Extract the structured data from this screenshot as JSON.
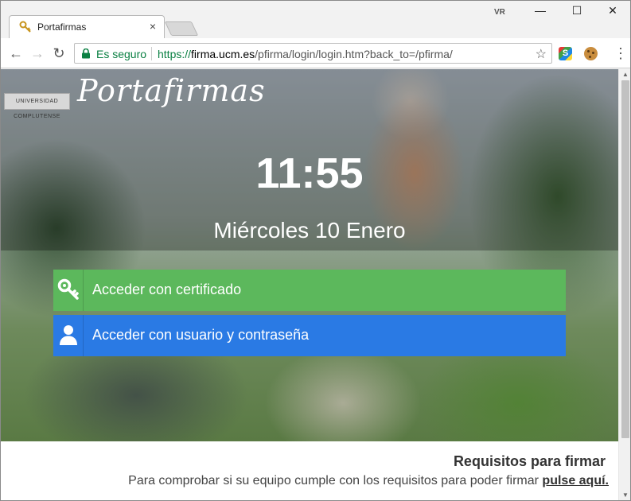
{
  "browser": {
    "tab_title": "Portafirmas",
    "tab_close": "×",
    "profile_badge": "VR",
    "window_min": "—",
    "window_max": "☐",
    "window_close": "✕",
    "secure_label": "Es seguro",
    "url_scheme": "https://",
    "url_host": "firma.ucm.es",
    "url_path": "/pfirma/login/login.htm?back_to=/pfirma/",
    "back": "←",
    "forward": "→",
    "reload": "↻",
    "bookmark": "☆",
    "extension_1": "S",
    "menu": "⋮",
    "icons": {
      "favicon": "key-icon",
      "lock": "lock-icon",
      "star": "star-icon",
      "extension_1": "extension-s-icon",
      "extension_2": "cookie-icon"
    }
  },
  "page": {
    "logo_institution": "UNIVERSIDAD COMPLUTENSE",
    "logo_text": "Portafirmas",
    "clock": "11:55",
    "date": "Miércoles 10 Enero",
    "buttons": {
      "certificate_label": "Acceder con certificado",
      "certificate_icon": "key-icon",
      "user_label": "Acceder con usuario y contraseña",
      "user_icon": "user-icon"
    },
    "requirements": {
      "title": "Requisitos para firmar",
      "text": "Para comprobar si su equipo cumple con los requisitos para poder firmar ",
      "link": "pulse aquí."
    }
  },
  "colors": {
    "certificate_button": "#5cb85c",
    "user_button": "#2a7ae4",
    "secure_green": "#0b8043"
  }
}
